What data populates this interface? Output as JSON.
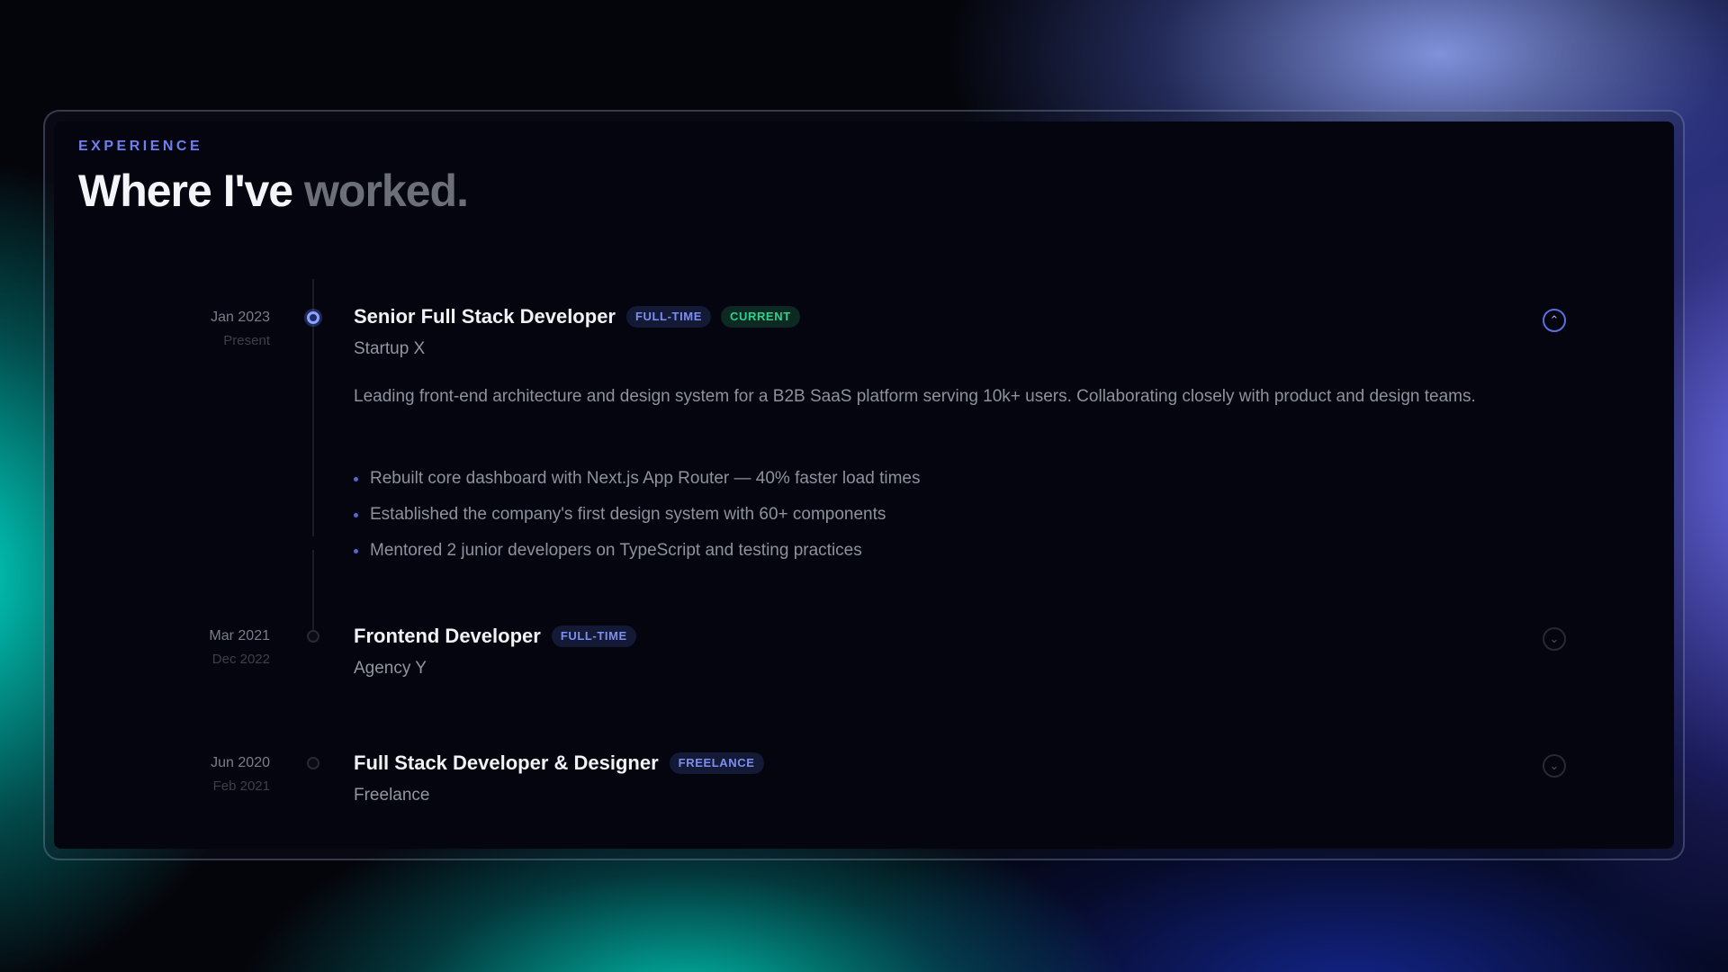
{
  "section": {
    "eyebrow": "EXPERIENCE",
    "title_main": "Where I've",
    "title_muted": "worked."
  },
  "jobs": [
    {
      "start": "Jan 2023",
      "end": "Present",
      "role": "Senior Full Stack Developer",
      "badges": [
        "FULL-TIME",
        "CURRENT"
      ],
      "company": "Startup X",
      "expanded": true,
      "description": "Leading front-end architecture and design system for a B2B SaaS platform serving 10k+ users. Collaborating closely with product and design teams.",
      "highlights": [
        "Rebuilt core dashboard with Next.js App Router — 40% faster load times",
        "Established the company's first design system with 60+ components",
        "Mentored 2 junior developers on TypeScript and testing practices"
      ]
    },
    {
      "start": "Mar 2021",
      "end": "Dec 2022",
      "role": "Frontend Developer",
      "badges": [
        "FULL-TIME"
      ],
      "company": "Agency Y",
      "expanded": false
    },
    {
      "start": "Jun 2020",
      "end": "Feb 2021",
      "role": "Full Stack Developer & Designer",
      "badges": [
        "FREELANCE"
      ],
      "company": "Freelance",
      "expanded": false
    }
  ],
  "icons": {
    "expanded": "chevron-up-icon",
    "collapsed": "chevron-down-icon"
  },
  "colors": {
    "accent": "#6f7ff0",
    "current_badge": "#2fcf8f",
    "panel_bg": "#04050e"
  }
}
